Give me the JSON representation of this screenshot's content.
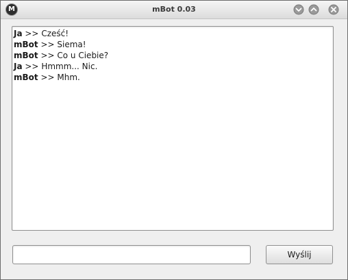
{
  "window": {
    "title": "mBot 0.03",
    "app_icon_letter": "M"
  },
  "chat": {
    "messages": [
      {
        "sender": "Ja",
        "separator": " >> ",
        "text": "Cześć!"
      },
      {
        "sender": "mBot",
        "separator": " >> ",
        "text": "Siema!"
      },
      {
        "sender": "mBot",
        "separator": " >> ",
        "text": "Co u Ciebie?"
      },
      {
        "sender": "Ja",
        "separator": " >> ",
        "text": "Hmmm... Nic."
      },
      {
        "sender": "mBot",
        "separator": " >> ",
        "text": "Mhm."
      }
    ]
  },
  "input": {
    "value": ""
  },
  "send_button": {
    "label": "Wyślij"
  },
  "titlebar_buttons": [
    "minimize-icon",
    "maximize-icon",
    "close-icon"
  ]
}
